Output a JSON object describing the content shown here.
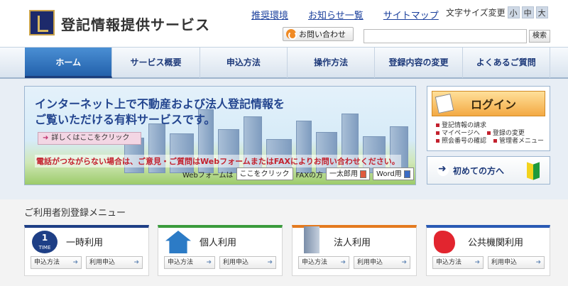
{
  "header": {
    "site_title": "登記情報提供サービス",
    "toplinks": [
      "推奨環境",
      "お知らせ一覧",
      "サイトマップ"
    ],
    "font_size_label": "文字サイズ変更",
    "font_sizes": [
      "小",
      "中",
      "大"
    ],
    "contact_label": "お問い合わせ",
    "search_placeholder": "",
    "search_button": "検索"
  },
  "nav": {
    "items": [
      "ホーム",
      "サービス概要",
      "申込方法",
      "操作方法",
      "登録内容の変更",
      "よくあるご質問"
    ],
    "active_index": 0
  },
  "banner": {
    "headline_line1": "インターネット上で不動産および法人登記情報を",
    "headline_line2": "ご覧いただける有料サービスです。",
    "detail_button": "詳しくはここをクリック",
    "notice": "電話がつながらない場合は、ご意見・ご質問はWebフォームまたはFAXによりお問い合わせください。",
    "webform_label": "Webフォームは",
    "webform_button": "ここをクリック",
    "fax_label": "FAXの方",
    "ichitaro_button": "一太郎用",
    "word_button": "Word用"
  },
  "login": {
    "button": "ログイン",
    "links": [
      "登記情報の請求",
      "マイページへ",
      "登録の変更",
      "照会番号の確認",
      "管理者メニュー"
    ]
  },
  "firsttime": {
    "button": "初めての方へ"
  },
  "registration": {
    "title": "ご利用者別登録メニュー",
    "time_badge_number": "1",
    "time_badge_word": "TIME",
    "cards": [
      {
        "title": "一時利用",
        "btn1": "申込方法",
        "btn2": "利用申込"
      },
      {
        "title": "個人利用",
        "btn1": "申込方法",
        "btn2": "利用申込"
      },
      {
        "title": "法人利用",
        "btn1": "申込方法",
        "btn2": "利用申込"
      },
      {
        "title": "公共機関利用",
        "btn1": "申込方法",
        "btn2": "利用申込"
      }
    ]
  },
  "colors": {
    "nav_active": "#2361ab",
    "link": "#1a3f9c",
    "notice_red": "#c3212e",
    "login_orange": "#f3a943"
  }
}
